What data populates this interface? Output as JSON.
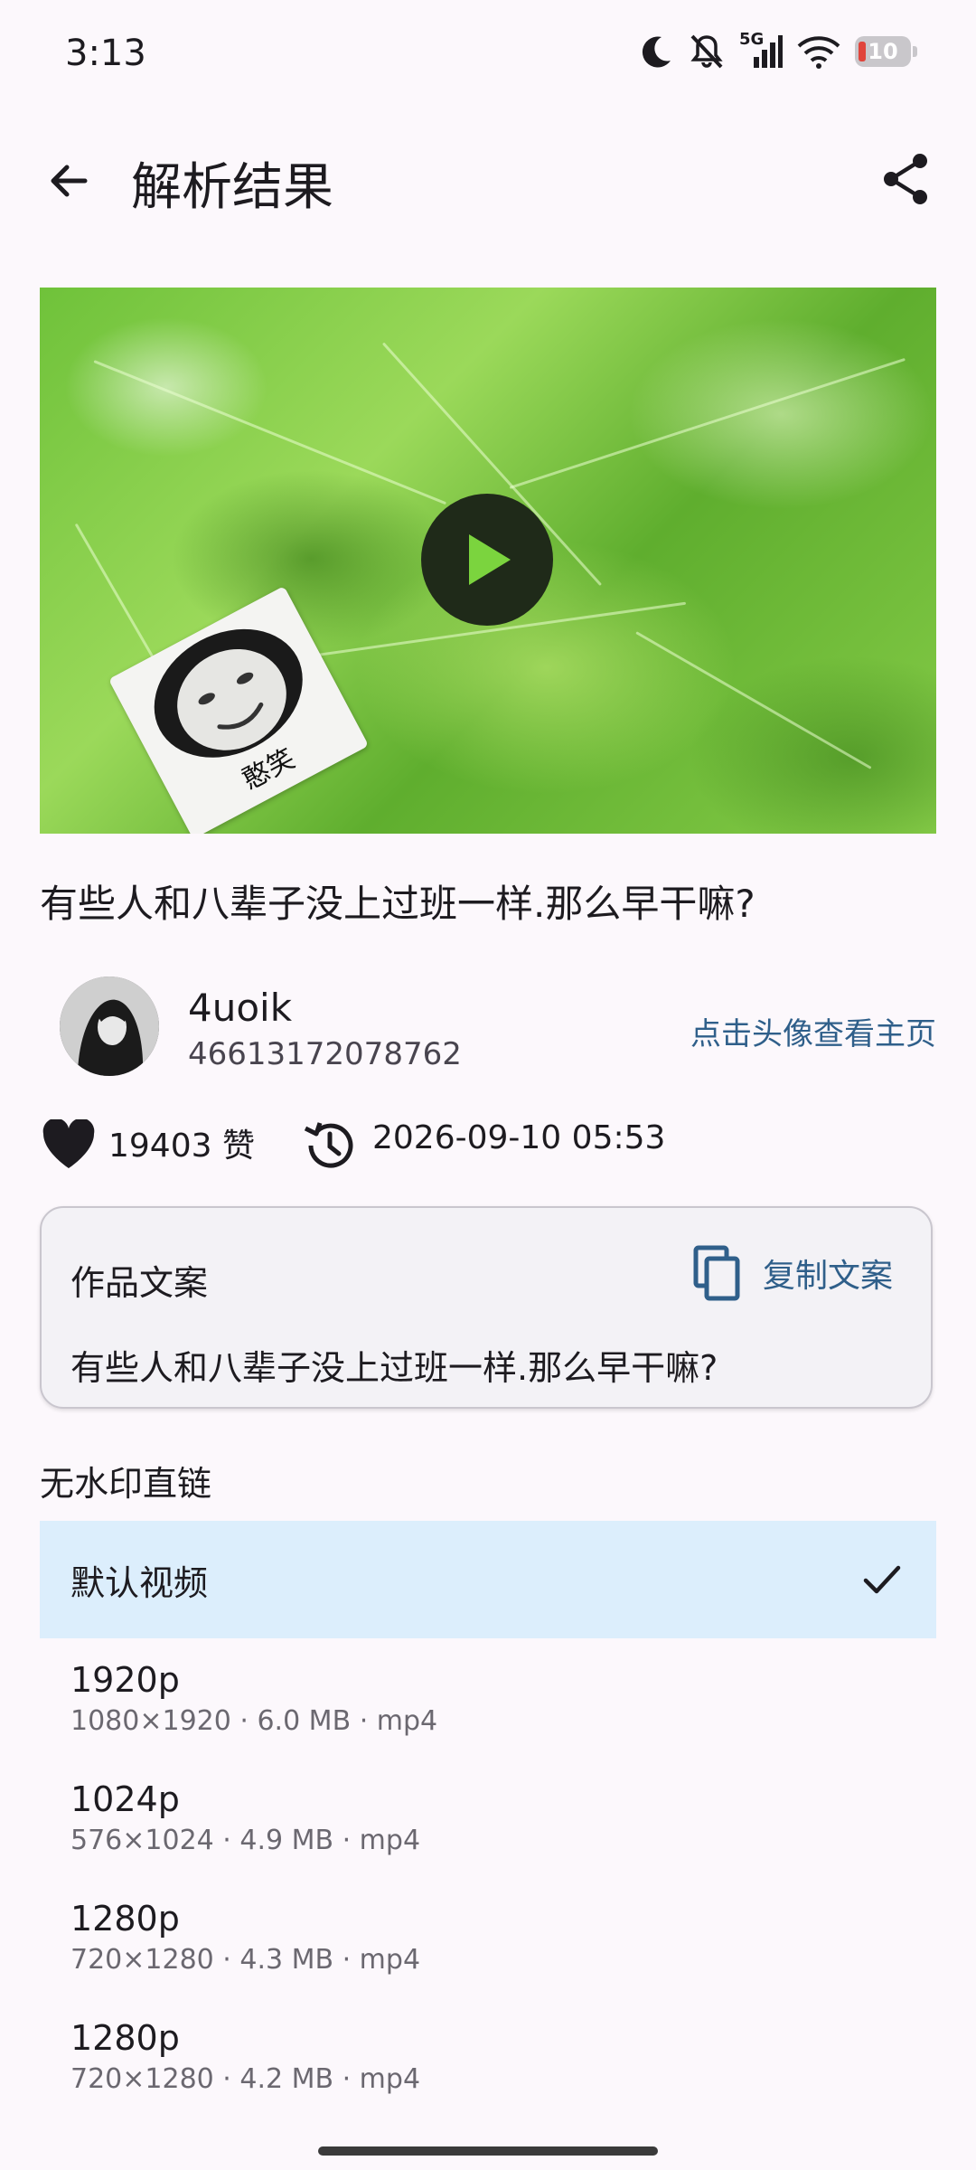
{
  "status_bar": {
    "time": "3:13",
    "network": "5G",
    "battery": "10",
    "icons": [
      "moon-icon",
      "mute-icon",
      "signal-icon",
      "wifi-icon",
      "battery-icon"
    ]
  },
  "app_bar": {
    "title": "解析结果",
    "back_icon": "back-arrow-icon",
    "share_icon": "share-icon"
  },
  "media": {
    "meme_caption": "憨笑",
    "play_icon": "play-icon"
  },
  "post": {
    "title": "有些人和八辈子没上过班一样.那么早干嘛?",
    "author_name": "4uoik",
    "author_id": "46613172078762",
    "author_link": "点击头像查看主页",
    "likes": "19403 赞",
    "time": "2026-09-10 05:53"
  },
  "caption_card": {
    "label": "作品文案",
    "copy_label": "复制文案",
    "text": "有些人和八辈子没上过班一样.那么早干嘛?"
  },
  "links": {
    "section_label": "无水印直链",
    "items": [
      {
        "label": "默认视频",
        "selected": true
      },
      {
        "label": "1920p",
        "detail": "1080×1920 · 6.0 MB · mp4"
      },
      {
        "label": "1024p",
        "detail": "576×1024 · 4.9 MB · mp4"
      },
      {
        "label": "1280p",
        "detail": "720×1280 · 4.3 MB · mp4"
      },
      {
        "label": "1280p",
        "detail": "720×1280 · 4.2 MB · mp4"
      }
    ]
  },
  "colors": {
    "background": "#fcf8fc",
    "accent": "#2f5f8a",
    "selected_bg": "#dceefc"
  }
}
